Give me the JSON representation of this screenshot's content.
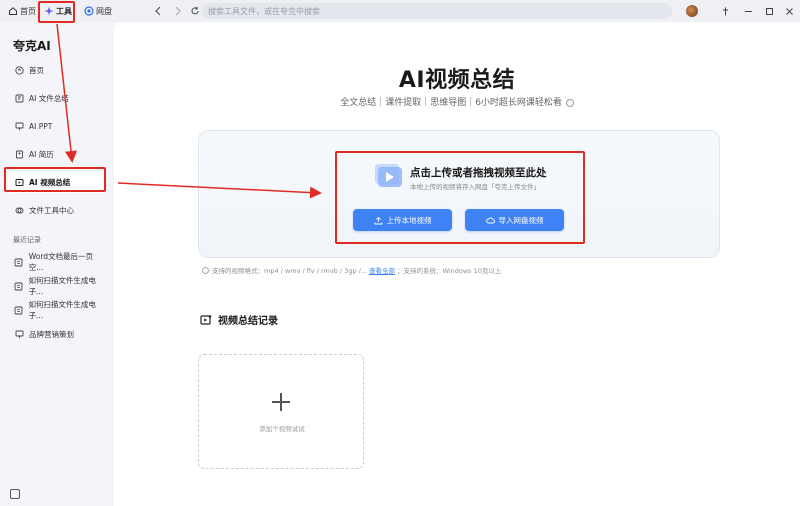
{
  "topbar": {
    "tabs": [
      {
        "label": "首页",
        "icon": "home-icon"
      },
      {
        "label": "工具",
        "icon": "sparkle-icon",
        "active": true
      },
      {
        "label": "网盘",
        "icon": "cloud-icon"
      }
    ],
    "search_placeholder": "搜索工具文件，或在夸克中搜索"
  },
  "sidebar": {
    "logo": "夸克AI",
    "items": [
      {
        "label": "首页",
        "icon": "home-icon"
      },
      {
        "label": "AI 文件总结",
        "icon": "ai-doc-icon"
      },
      {
        "label": "AI PPT",
        "icon": "ppt-icon"
      },
      {
        "label": "AI 简历",
        "icon": "resume-icon"
      },
      {
        "label": "AI 视频总结",
        "icon": "video-summary-icon",
        "active": true
      },
      {
        "label": "文件工具中心",
        "icon": "tool-center-icon"
      }
    ],
    "recent_title": "最近记录",
    "recent": [
      {
        "label": "Word文档最后一页空...",
        "icon": "list-icon"
      },
      {
        "label": "如何扫描文件生成电子...",
        "icon": "list-icon"
      },
      {
        "label": "如何扫描文件生成电子...",
        "icon": "list-icon"
      },
      {
        "label": "品牌营销策划",
        "icon": "ppt-icon"
      }
    ]
  },
  "main": {
    "title": "AI视频总结",
    "subtitle": "全文总结｜课件提取｜思维导图｜6小时超长网课轻松看",
    "upload": {
      "title": "点击上传或者拖拽视频至此处",
      "hint": "本地上传的视频将存入网盘「夸克上传文件」",
      "btn_local": "上传本地视频",
      "btn_cloud": "导入网盘视频"
    },
    "support": {
      "prefix": "支持的视频格式：mp4 / wmv / flv / rmvb / 3gp /...",
      "link": "查看全部",
      "suffix": "；支持的系统：Windows 10及以上"
    },
    "records_title": "视频总结记录",
    "add_label": "添加个视频试试"
  },
  "colors": {
    "accent": "#3f82f5",
    "annotation_red": "#e02b25"
  }
}
